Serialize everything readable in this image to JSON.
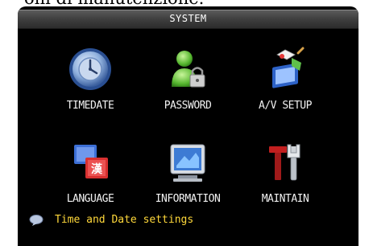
{
  "caption_fragment": "oni di manutenzione.",
  "window": {
    "title": "SYSTEM"
  },
  "menu": [
    {
      "label": "TIMEDATE",
      "icon": "clock-icon"
    },
    {
      "label": "PASSWORD",
      "icon": "user-lock-icon"
    },
    {
      "label": "A/V SETUP",
      "icon": "av-setup-icon"
    },
    {
      "label": "LANGUAGE",
      "icon": "language-icon"
    },
    {
      "label": "INFORMATION",
      "icon": "information-icon"
    },
    {
      "label": "MAINTAIN",
      "icon": "tools-icon"
    }
  ],
  "status": {
    "icon": "speech-bubble-icon",
    "text": "Time and Date settings",
    "text_color": "#ffd83a"
  }
}
